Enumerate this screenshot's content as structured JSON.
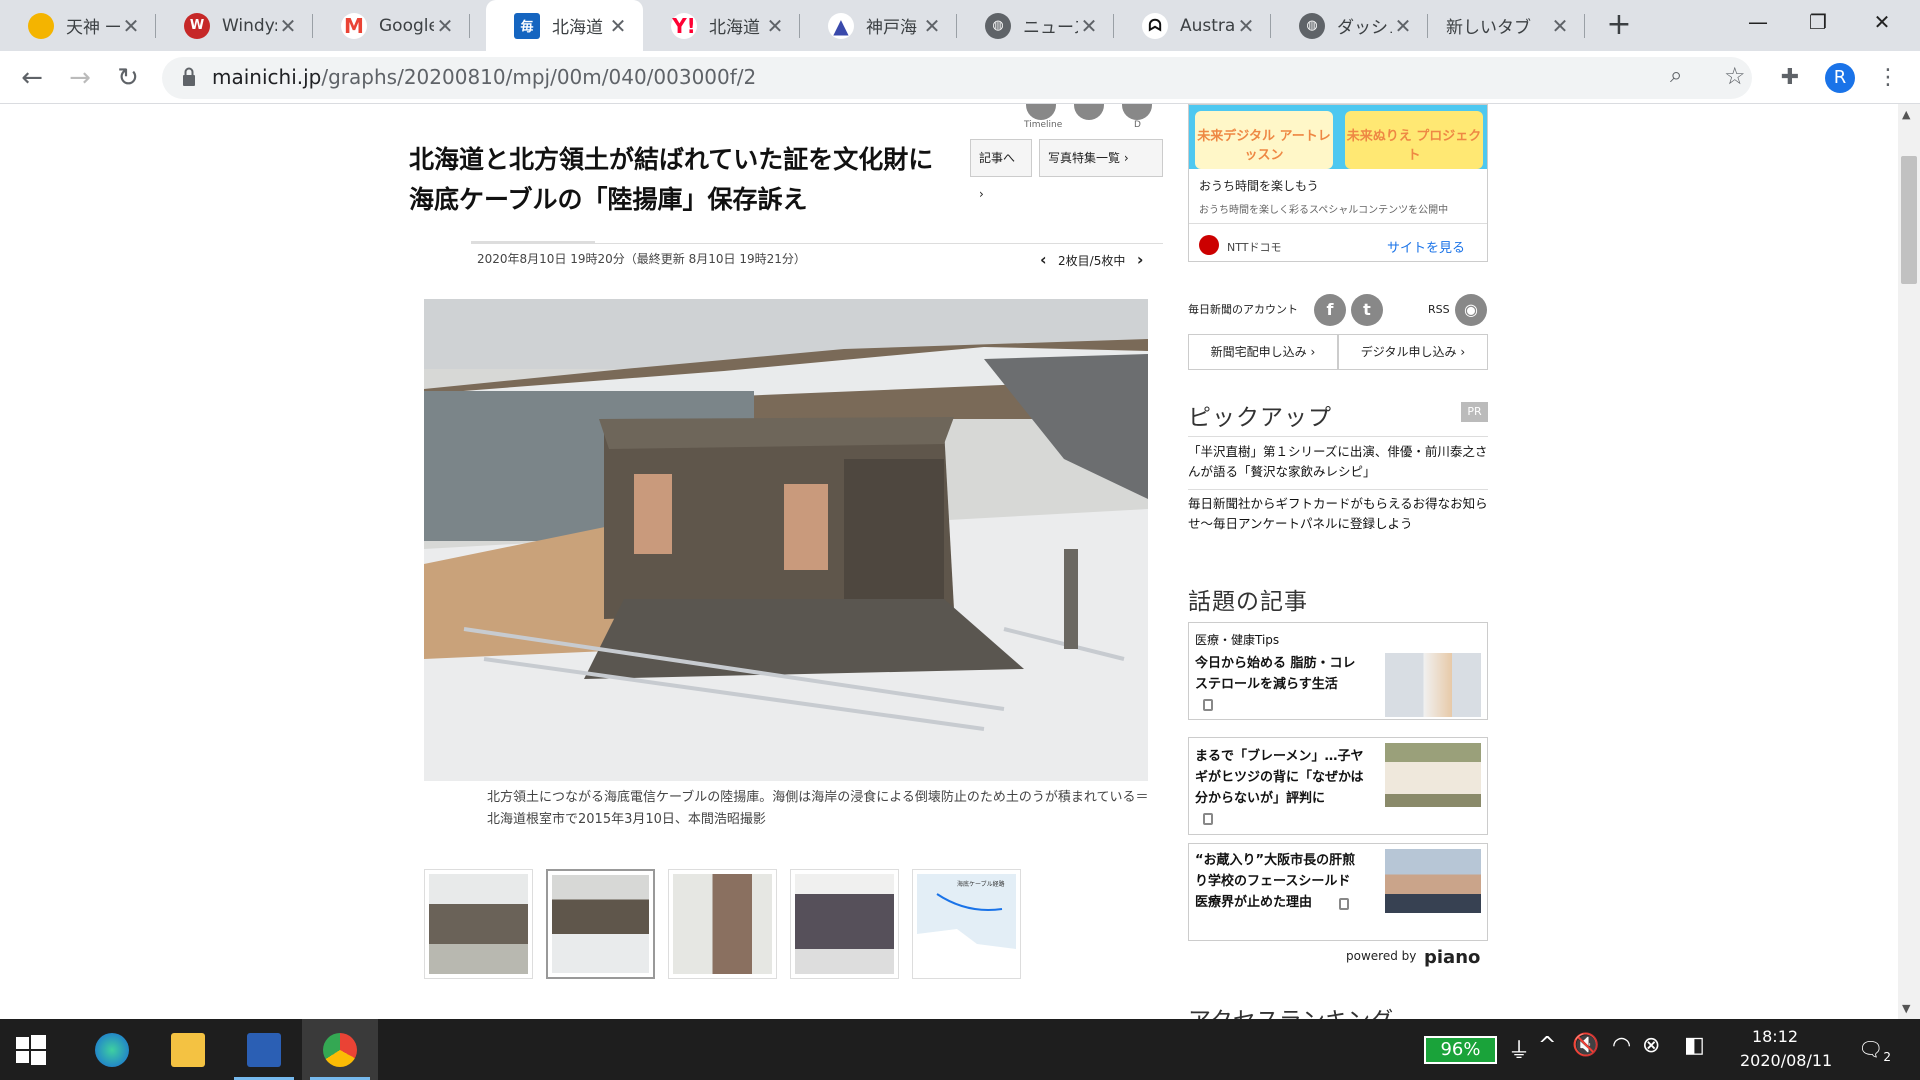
{
  "browser": {
    "tabs": [
      {
        "title": "天神 一",
        "favicon": "weather-sun-icon",
        "color": "#f4b400"
      },
      {
        "title": "Windy:",
        "favicon": "windy-icon",
        "color": "#c62828"
      },
      {
        "title": "Google",
        "favicon": "gmail-icon",
        "color": "#ea4335"
      },
      {
        "title": "北海道",
        "favicon": "mainichi-icon",
        "color": "#1565c0"
      },
      {
        "title": "北海道",
        "favicon": "yahoo-icon",
        "color": "#ff0033"
      },
      {
        "title": "神戸海",
        "favicon": "ship-icon",
        "color": "#3949ab"
      },
      {
        "title": "ニュース",
        "favicon": "globe-icon",
        "color": "#5f6368"
      },
      {
        "title": "Australi",
        "favicon": "abc-icon",
        "color": "#111111"
      },
      {
        "title": "ダッシュ",
        "favicon": "globe-icon",
        "color": "#5f6368"
      },
      {
        "title": "新しいタブ",
        "favicon": "",
        "color": ""
      }
    ],
    "active_tab": 3,
    "url_host": "mainichi.jp",
    "url_path": "/graphs/20200810/mpj/00m/040/003000f/2"
  },
  "article": {
    "social_labels": [
      "Timeline",
      "D"
    ],
    "title": "北海道と北方領土が結ばれていた証を文化財に　海底ケーブルの「陸揚庫」保存訴え",
    "btn_article": "記事へ",
    "btn_gallery": "写真特集一覧",
    "date": "2020年8月10日 19時20分（最終更新 8月10日 19時21分）",
    "pager": "2枚目/5枚中",
    "caption": "北方領土につながる海底電信ケーブルの陸揚庫。海側は海岸の浸食による倒壊防止のため土のうが積まれている＝北海道根室市で2015年3月10日、本間浩昭撮影",
    "thumbs_count": 5,
    "selected_thumb": 2,
    "map_thumb_label": "海底ケーブル経路"
  },
  "sidebar": {
    "ad": {
      "card1": "未来デジタル アートレッスン",
      "card2": "未来ぬりえ プロジェクト",
      "headline": "おうち時間を楽しもう",
      "sub": "おうち時間を楽しく彩るスペシャルコンテンツを公開中",
      "brand": "NTTドコモ",
      "cta": "サイトを見る"
    },
    "account_label": "毎日新聞のアカウント",
    "rss_label": "RSS",
    "btn_delivery": "新聞宅配申し込み",
    "btn_digital": "デジタル申し込み",
    "pickup_title": "ピックアップ",
    "pr_badge": "PR",
    "pickups": [
      "「半沢直樹」第１シリーズに出演、俳優・前川泰之さんが語る「贅沢な家飲みレシピ」",
      "毎日新聞社からギフトカードがもらえるお得なお知らせ～毎日アンケートパネルに登録しよう"
    ],
    "topics_title": "話題の記事",
    "topic_category": "医療・健康Tips",
    "topics": [
      "今日から始める 脂肪・コレステロールを減らす生活",
      "まるで「ブレーメン」…子ヤギがヒツジの背に「なぜかは分からないが」評判に",
      "“お蔵入り”大阪市長の肝煎り学校のフェースシールド 医療界が止めた理由"
    ],
    "powered_by": "powered by",
    "piano": "piano",
    "ranking_title": "アクセスランキング"
  },
  "taskbar": {
    "battery": "96%",
    "time": "18:12",
    "date": "2020/08/11",
    "notifications": "2"
  }
}
